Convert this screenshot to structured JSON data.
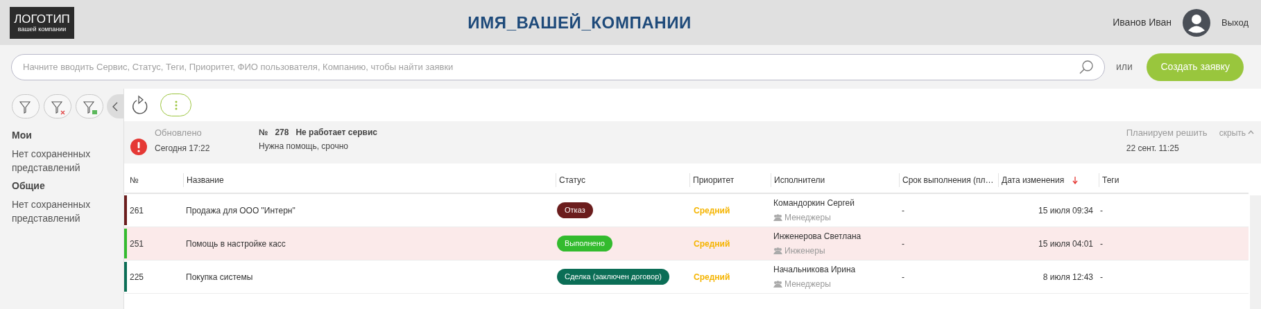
{
  "header": {
    "logo": {
      "line1": "ЛОГОТИП",
      "line2": "вашей компании"
    },
    "title": "ИМЯ_ВАШЕЙ_КОМПАНИИ",
    "user_name": "Иванов Иван",
    "logout": "Выход"
  },
  "search": {
    "placeholder": "Начните вводить Сервис, Статус, Теги, Приоритет, ФИО пользователя, Компанию, чтобы найти заявки",
    "or_label": "или",
    "create_button": "Создать заявку"
  },
  "sidebar": {
    "sections": [
      {
        "title": "Мои",
        "empty_text": "Нет сохраненных представлений"
      },
      {
        "title": "Общие",
        "empty_text": "Нет сохраненных представлений"
      }
    ]
  },
  "notice": {
    "updated_label": "Обновлено",
    "updated_value": "Сегодня 17:22",
    "number_label": "№",
    "number": "278",
    "subject": "Не работает сервис",
    "description": "Нужна помощь, срочно",
    "plan_label": "Планируем решить",
    "plan_value": "22 сент. 11:25",
    "hide_link": "скрыть"
  },
  "table": {
    "columns": [
      {
        "label": "№",
        "sorted": false
      },
      {
        "label": "Название",
        "sorted": false
      },
      {
        "label": "Статус",
        "sorted": false
      },
      {
        "label": "Приоритет",
        "sorted": false
      },
      {
        "label": "Исполнители",
        "sorted": false
      },
      {
        "label": "Срок выполнения (пл…",
        "sorted": false
      },
      {
        "label": "Дата изменения",
        "sorted": true
      },
      {
        "label": "Теги",
        "sorted": false
      }
    ],
    "rows": [
      {
        "number": "261",
        "title": "Продажа для ООО \"Интерн\"",
        "status": "Отказ",
        "color": "#6b1d1d",
        "priority": "Средний",
        "assignee": "Командоркин Сергей",
        "group": "Менеджеры",
        "deadline": "-",
        "modified": "15 июля 09:34",
        "tags": "-",
        "selected": false
      },
      {
        "number": "251",
        "title": "Помощь в настройке касс",
        "status": "Выполнено",
        "color": "#33bb2e",
        "priority": "Средний",
        "assignee": "Инженерова Светлана",
        "group": "Инженеры",
        "deadline": "-",
        "modified": "15 июля 04:01",
        "tags": "-",
        "selected": true
      },
      {
        "number": "225",
        "title": "Покупка системы",
        "status": "Сделка (заключен договор)",
        "color": "#0b6e56",
        "priority": "Средний",
        "assignee": "Начальникова Ирина",
        "group": "Менеджеры",
        "deadline": "-",
        "modified": "8 июля 12:43",
        "tags": "-",
        "selected": false
      }
    ]
  }
}
